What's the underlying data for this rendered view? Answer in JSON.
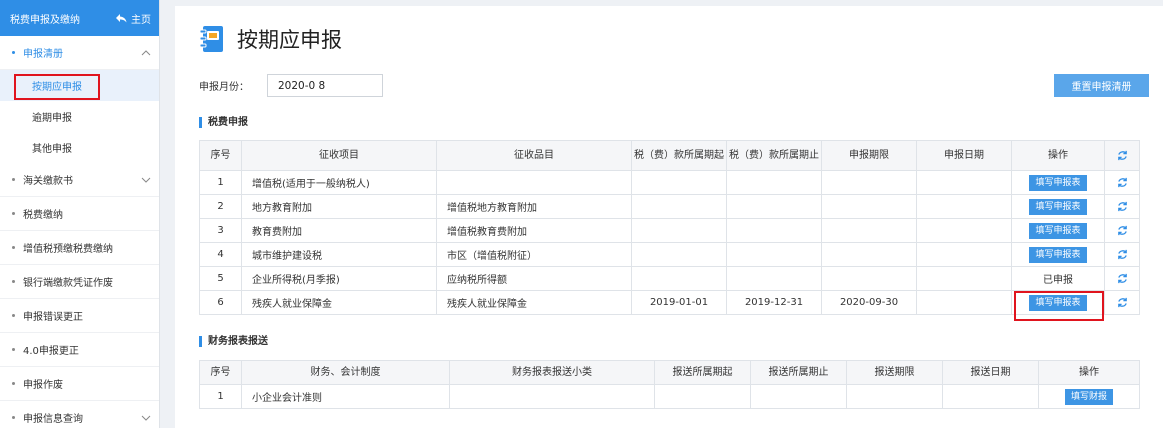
{
  "sidebar": {
    "header_title": "税费申报及缴纳",
    "home_label": "主页",
    "groups": [
      {
        "label": "申报清册",
        "expanded": true,
        "subitems": [
          {
            "label": "按期应申报"
          },
          {
            "label": "逾期申报"
          },
          {
            "label": "其他申报"
          }
        ]
      },
      {
        "label": "海关缴款书"
      },
      {
        "label": "税费缴纳"
      },
      {
        "label": "增值税预缴税费缴纳"
      },
      {
        "label": "银行端缴款凭证作废"
      },
      {
        "label": "申报错误更正"
      },
      {
        "label": "4.0申报更正"
      },
      {
        "label": "申报作废"
      },
      {
        "label": "申报信息查询"
      }
    ]
  },
  "main": {
    "title": "按期应申报",
    "month_label": "申报月份：",
    "month_value": "2020-0 8",
    "reset_button": "重置申报清册",
    "tax_section": {
      "title": "税费申报",
      "headers": [
        "序号",
        "征收项目",
        "征收品目",
        "税（费）款所属期起",
        "税（费）款所属期止",
        "申报期限",
        "申报日期",
        "操作"
      ],
      "rows": [
        {
          "no": "1",
          "item": "增值税(适用于一般纳税人)",
          "subitem": "",
          "start": "",
          "end": "",
          "deadline": "",
          "date": "",
          "action": "填写申报表"
        },
        {
          "no": "2",
          "item": "地方教育附加",
          "subitem": "增值税地方教育附加",
          "start": "",
          "end": "",
          "deadline": "",
          "date": "",
          "action": "填写申报表"
        },
        {
          "no": "3",
          "item": "教育费附加",
          "subitem": "增值税教育费附加",
          "start": "",
          "end": "",
          "deadline": "",
          "date": "",
          "action": "填写申报表"
        },
        {
          "no": "4",
          "item": "城市维护建设税",
          "subitem": "市区（增值税附征）",
          "start": "",
          "end": "",
          "deadline": "",
          "date": "",
          "action": "填写申报表"
        },
        {
          "no": "5",
          "item": "企业所得税(月季报)",
          "subitem": "应纳税所得额",
          "start": "",
          "end": "",
          "deadline": "",
          "date": "",
          "action": "已申报"
        },
        {
          "no": "6",
          "item": "残疾人就业保障金",
          "subitem": "残疾人就业保障金",
          "start": "2019-01-01",
          "end": "2019-12-31",
          "deadline": "2020-09-30",
          "date": "",
          "action": "填写申报表"
        }
      ]
    },
    "fin_section": {
      "title": "财务报表报送",
      "headers": [
        "序号",
        "财务、会计制度",
        "财务报表报送小类",
        "报送所属期起",
        "报送所属期止",
        "报送期限",
        "报送日期",
        "操作"
      ],
      "rows": [
        {
          "no": "1",
          "system": "小企业会计准则",
          "subtype": "",
          "start": "",
          "end": "",
          "deadline": "",
          "date": "",
          "action": "填写财报"
        }
      ]
    }
  },
  "colors": {
    "accent": "#2f8ee6",
    "button": "#3d95e4",
    "highlight": "#e0141e"
  }
}
